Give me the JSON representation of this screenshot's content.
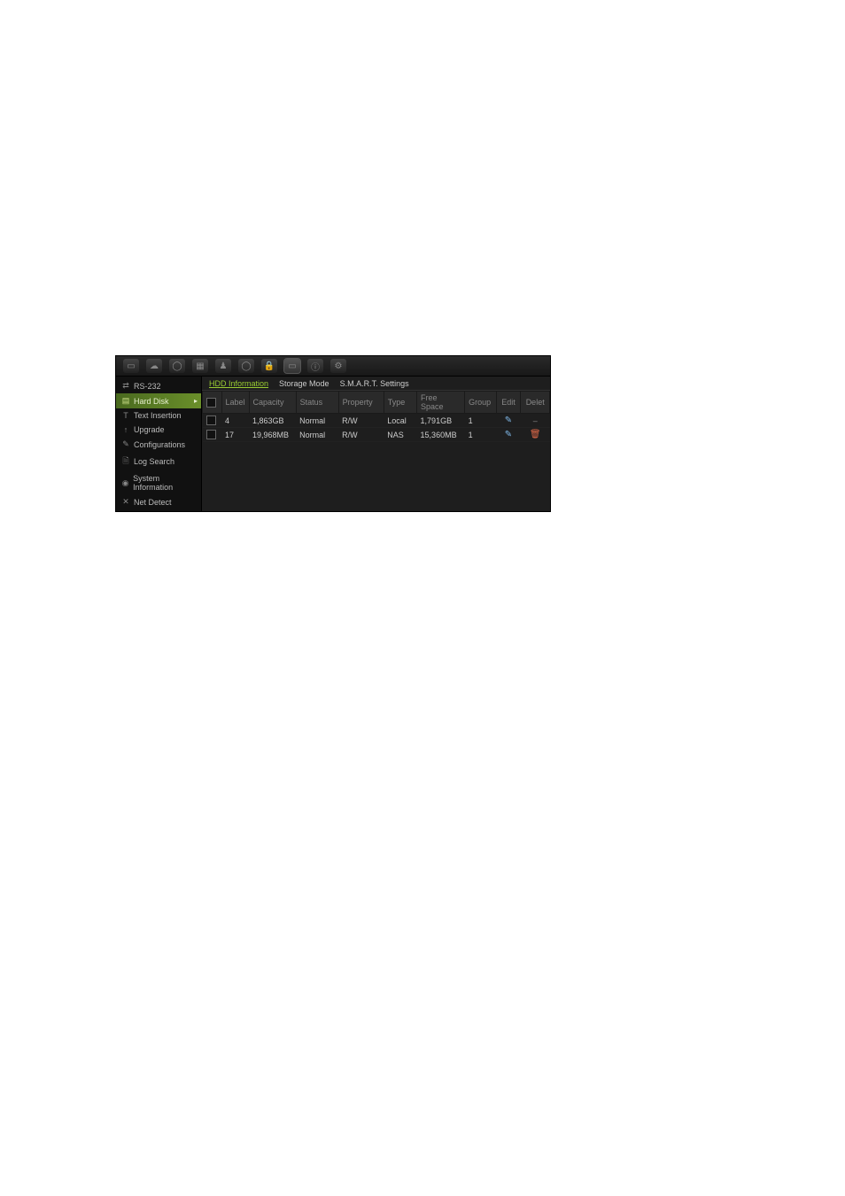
{
  "sidebar": {
    "items": [
      {
        "label": "RS-232",
        "icon": "⇄"
      },
      {
        "label": "Hard Disk",
        "icon": "▤"
      },
      {
        "label": "Text Insertion",
        "icon": "T"
      },
      {
        "label": "Upgrade",
        "icon": "↑"
      },
      {
        "label": "Configurations",
        "icon": "✎"
      },
      {
        "label": "Log Search",
        "icon": "🗎"
      },
      {
        "label": "System Information",
        "icon": "◉"
      },
      {
        "label": "Net Detect",
        "icon": "✕"
      }
    ],
    "active_index": 1
  },
  "tabs": {
    "items": [
      "HDD Information",
      "Storage Mode",
      "S.M.A.R.T. Settings"
    ],
    "active_index": 0
  },
  "table": {
    "headers": [
      "",
      "Label",
      "Capacity",
      "Status",
      "Property",
      "Type",
      "Free Space",
      "Group",
      "Edit",
      "Delet"
    ],
    "rows": [
      {
        "label": "4",
        "capacity": "1,863GB",
        "status": "Normal",
        "property": "R/W",
        "type": "Local",
        "free": "1,791GB",
        "group": "1",
        "deletable": false
      },
      {
        "label": "17",
        "capacity": "19,968MB",
        "status": "Normal",
        "property": "R/W",
        "type": "NAS",
        "free": "15,360MB",
        "group": "1",
        "deletable": true
      }
    ]
  }
}
